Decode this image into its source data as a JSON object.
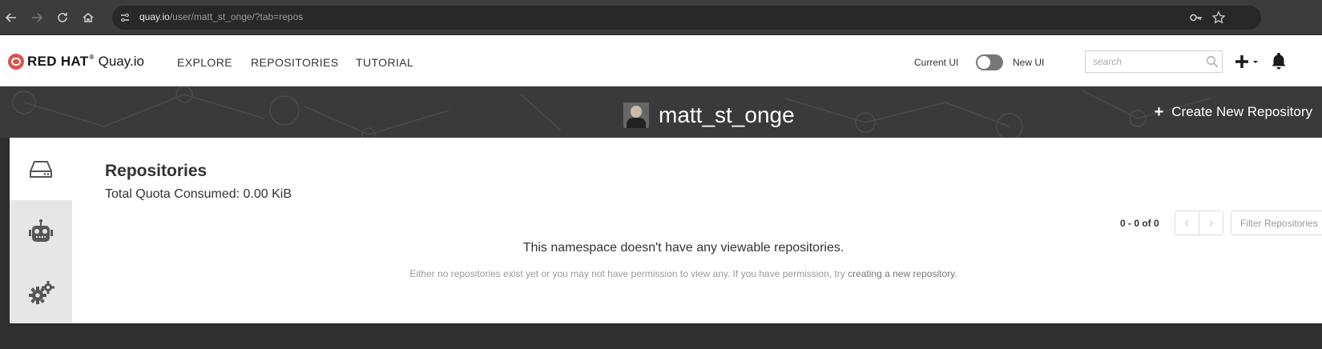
{
  "browser": {
    "url_host": "quay.io",
    "url_path": "/user/matt_st_onge/?tab=repos",
    "icons": [
      "back-icon",
      "forward-icon",
      "reload-icon",
      "home-icon",
      "site-info-icon",
      "password-key-icon",
      "bookmark-star-icon"
    ]
  },
  "header": {
    "brand_redhat": "RED HAT",
    "brand_reg": "®",
    "brand_product": "Quay.io",
    "nav": [
      "EXPLORE",
      "REPOSITORIES",
      "TUTORIAL"
    ],
    "current_ui_label": "Current UI",
    "new_ui_label": "New UI",
    "search_placeholder": "search",
    "icons": [
      "search-icon",
      "plus-icon",
      "bell-icon"
    ]
  },
  "banner": {
    "username": "matt_st_onge",
    "create_repo_icon": "+",
    "create_repo_label": "Create New Repository"
  },
  "side_tabs": [
    {
      "icon": "hard-drive-icon",
      "active": true
    },
    {
      "icon": "robot-icon",
      "active": false
    },
    {
      "icon": "gears-icon",
      "active": false
    }
  ],
  "content": {
    "title": "Repositories",
    "quota": "Total Quota Consumed: 0.00 KiB",
    "pager": "0 - 0 of 0",
    "pager_prev": "‹",
    "pager_next": "›",
    "filter_placeholder": "Filter Repositories",
    "empty_title": "This namespace doesn't have any viewable repositories.",
    "empty_desc_prefix": "Either no repositories exist yet or you may not have permission to view any. If you have permission, try ",
    "empty_desc_link": "creating a new repository",
    "empty_desc_suffix": "."
  },
  "colors": {
    "banner_bg": "#3a3a3a",
    "page_bg": "#2f2f2f",
    "redhat_red": "#d9534f",
    "side_tab_bg": "#e6e6e6"
  }
}
